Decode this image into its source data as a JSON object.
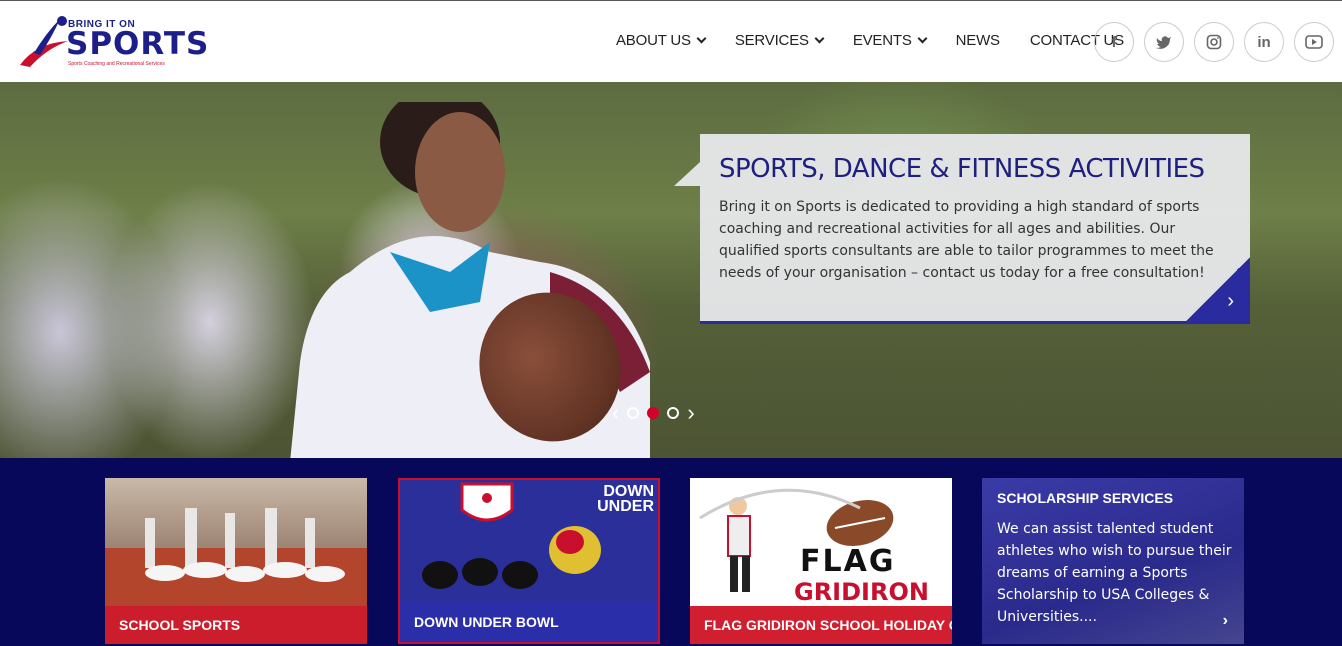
{
  "logo": {
    "line1": "BRING IT ON",
    "line2": "SPORTS",
    "tagline": "Sports Coaching and Recreational Services"
  },
  "nav": {
    "items": [
      {
        "label": "ABOUT US",
        "dropdown": true
      },
      {
        "label": "SERVICES",
        "dropdown": true
      },
      {
        "label": "EVENTS",
        "dropdown": true
      },
      {
        "label": "NEWS",
        "dropdown": false
      },
      {
        "label": "CONTACT US",
        "dropdown": false
      }
    ]
  },
  "social": {
    "icons": [
      {
        "name": "facebook-icon",
        "glyph": "f"
      },
      {
        "name": "twitter-icon",
        "glyph": "🐦"
      },
      {
        "name": "instagram-icon",
        "glyph": "◎"
      },
      {
        "name": "linkedin-icon",
        "glyph": "in"
      },
      {
        "name": "youtube-icon",
        "glyph": "▶"
      }
    ]
  },
  "hero": {
    "title": "SPORTS, DANCE & FITNESS ACTIVITIES",
    "text": "Bring it on Sports is dedicated to providing a high standard of sports coaching and recreational activities for all ages and abilities. Our qualified sports consultants are able to tailor programmes to meet the needs of your organisation – contact us today for a free consultation!",
    "prev_glyph": "‹",
    "next_glyph": "›",
    "caption_next_glyph": "›",
    "slides": 3,
    "active_slide": 2
  },
  "cards": [
    {
      "label": "SCHOOL SPORTS"
    },
    {
      "label": "DOWN UNDER BOWL",
      "logo_text_line1": "DOWN",
      "logo_text_line2": "UNDER"
    },
    {
      "label": "FLAG GRIDIRON SCHOOL HOLIDAY C...",
      "art_line1": "FLAG",
      "art_line2": "GRIDIRON"
    },
    {
      "title": "SCHOLARSHIP SERVICES",
      "text": "We can assist talented student athletes who wish to pursue their dreams of earning a Sports Scholarship to USA Colleges & Universities....",
      "chev": "›"
    }
  ],
  "colors": {
    "brand_navy": "#1c1f8a",
    "brand_red": "#c8102e",
    "band_bg": "#07085a",
    "card_red": "#cc1d2c"
  }
}
